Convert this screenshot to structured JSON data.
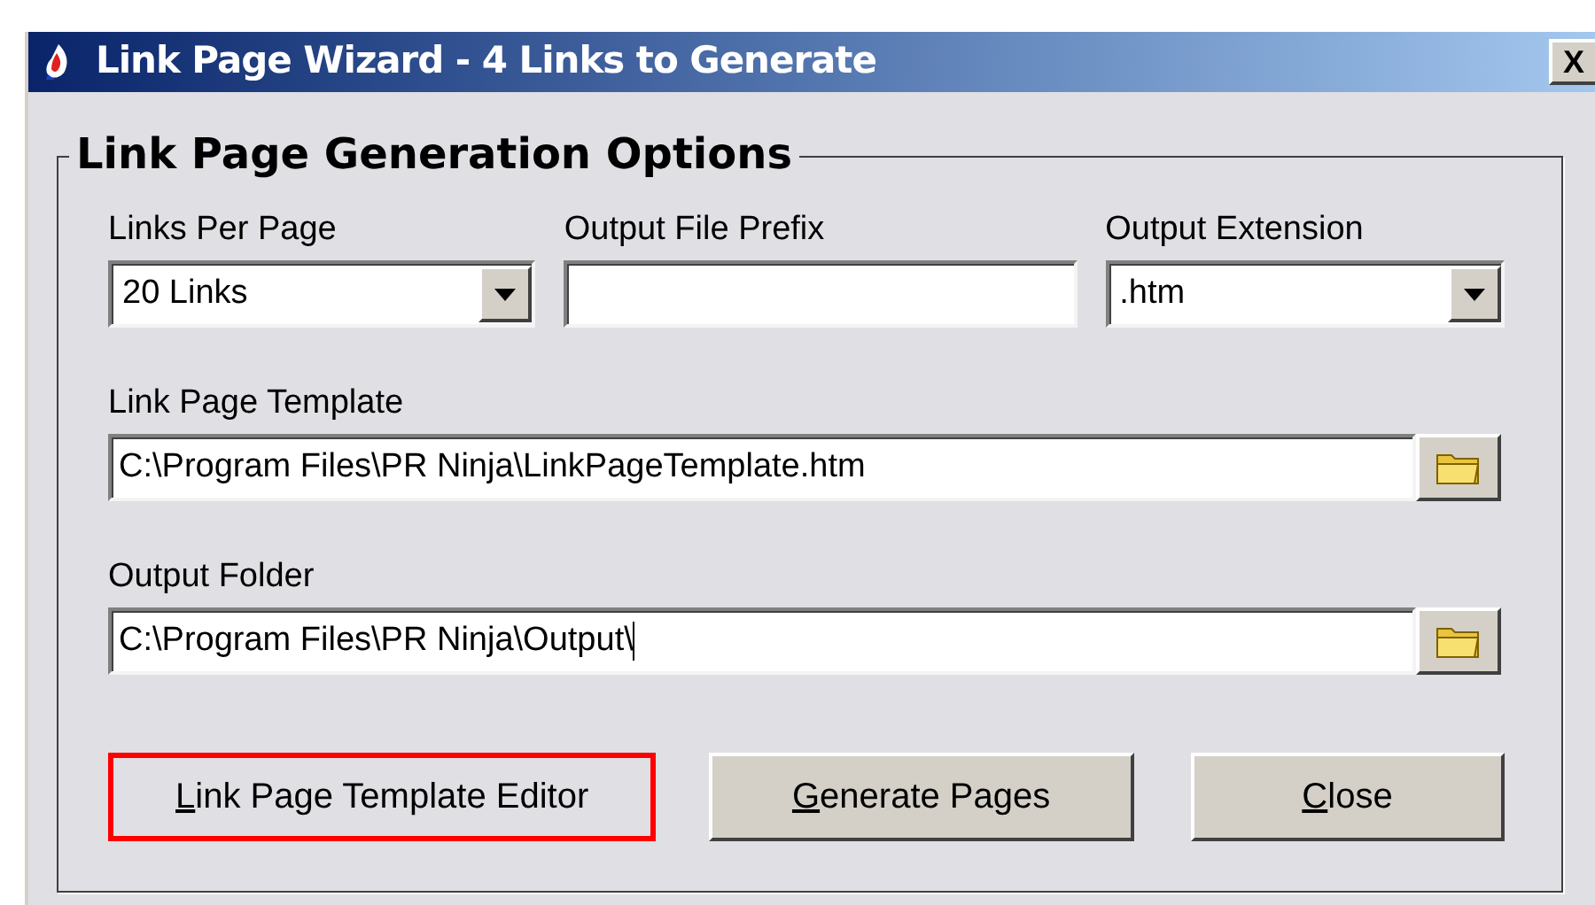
{
  "window": {
    "title": "Link Page Wizard - 4 Links to Generate",
    "close": "X"
  },
  "group": {
    "title": "Link Page Generation Options"
  },
  "top_fields": [
    {
      "kind": "dropdown",
      "label": "Links Per Page",
      "value": "20 Links"
    },
    {
      "kind": "text",
      "label": "Output File Prefix"
    },
    {
      "kind": "dropdown",
      "label": "Output Extension",
      "value": ".htm"
    }
  ],
  "path_fields": [
    {
      "label": "Link Page Template",
      "value": "C:\\Program Files\\PR Ninja\\LinkPageTemplate.htm",
      "focused": false
    },
    {
      "label": "Output Folder",
      "value": "C:\\Program Files\\PR Ninja\\Output\\",
      "focused": true
    }
  ],
  "buttons": [
    {
      "label": "Link Page Template Editor",
      "highlighted": true,
      "mnemonic_first": true
    },
    {
      "label": "Generate Pages",
      "highlighted": false,
      "mnemonic_first": true
    },
    {
      "label": "Close",
      "highlighted": false,
      "mnemonic_first": true
    }
  ]
}
